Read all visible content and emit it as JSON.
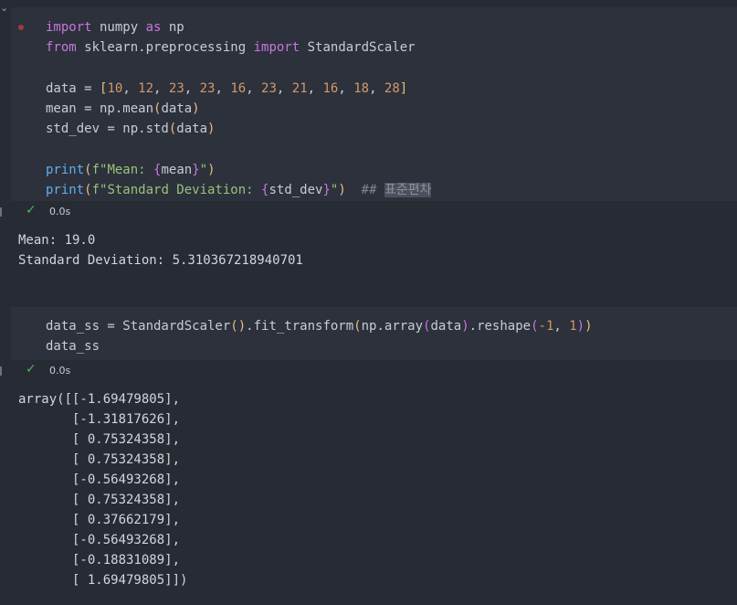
{
  "cell1": {
    "lines": [
      [
        [
          "kw",
          "import"
        ],
        [
          "id",
          " numpy "
        ],
        [
          "kw",
          "as"
        ],
        [
          "id",
          " np"
        ]
      ],
      [
        [
          "kw",
          "from"
        ],
        [
          "id",
          " sklearn.preprocessing "
        ],
        [
          "kw",
          "import"
        ],
        [
          "id",
          " StandardScaler"
        ]
      ],
      [],
      [
        [
          "id",
          "data = "
        ],
        [
          "br1",
          "["
        ],
        [
          "num",
          "10"
        ],
        [
          "id",
          ", "
        ],
        [
          "num",
          "12"
        ],
        [
          "id",
          ", "
        ],
        [
          "num",
          "23"
        ],
        [
          "id",
          ", "
        ],
        [
          "num",
          "23"
        ],
        [
          "id",
          ", "
        ],
        [
          "num",
          "16"
        ],
        [
          "id",
          ", "
        ],
        [
          "num",
          "23"
        ],
        [
          "id",
          ", "
        ],
        [
          "num",
          "21"
        ],
        [
          "id",
          ", "
        ],
        [
          "num",
          "16"
        ],
        [
          "id",
          ", "
        ],
        [
          "num",
          "18"
        ],
        [
          "id",
          ", "
        ],
        [
          "num",
          "28"
        ],
        [
          "br1",
          "]"
        ]
      ],
      [
        [
          "id",
          "mean = np.mean"
        ],
        [
          "br1",
          "("
        ],
        [
          "id",
          "data"
        ],
        [
          "br1",
          ")"
        ]
      ],
      [
        [
          "id",
          "std_dev = np.std"
        ],
        [
          "br1",
          "("
        ],
        [
          "id",
          "data"
        ],
        [
          "br1",
          ")"
        ]
      ],
      [],
      [
        [
          "fn",
          "print"
        ],
        [
          "br1",
          "("
        ],
        [
          "str",
          "f\"Mean: "
        ],
        [
          "br2",
          "{"
        ],
        [
          "id",
          "mean"
        ],
        [
          "br2",
          "}"
        ],
        [
          "str",
          "\""
        ],
        [
          "br1",
          ")"
        ]
      ],
      [
        [
          "fn",
          "print"
        ],
        [
          "br1",
          "("
        ],
        [
          "str",
          "f\"Standard Deviation: "
        ],
        [
          "br2",
          "{"
        ],
        [
          "id",
          "std_dev"
        ],
        [
          "br2",
          "}"
        ],
        [
          "str",
          "\""
        ],
        [
          "br1",
          ")"
        ],
        [
          "id",
          "  "
        ],
        [
          "cmt",
          "## "
        ],
        [
          "cmt-hl",
          "표준편차"
        ]
      ]
    ],
    "status_time": "0.0s",
    "output": "Mean: 19.0\nStandard Deviation: 5.310367218940701"
  },
  "cell2": {
    "lines": [
      [
        [
          "id",
          "data_ss = StandardScaler"
        ],
        [
          "br1",
          "()"
        ],
        [
          "id",
          ".fit_transform"
        ],
        [
          "br1",
          "("
        ],
        [
          "id",
          "np.array"
        ],
        [
          "br2",
          "("
        ],
        [
          "id",
          "data"
        ],
        [
          "br2",
          ")"
        ],
        [
          "id",
          ".reshape"
        ],
        [
          "br2",
          "("
        ],
        [
          "num",
          "-1"
        ],
        [
          "id",
          ", "
        ],
        [
          "num",
          "1"
        ],
        [
          "br2",
          ")"
        ],
        [
          "br1",
          ")"
        ]
      ],
      [
        [
          "id",
          "data_ss"
        ]
      ]
    ],
    "status_time": "0.0s",
    "output": "array([[-1.69479805],\n       [-1.31817626],\n       [ 0.75324358],\n       [ 0.75324358],\n       [-0.56493268],\n       [ 0.75324358],\n       [ 0.37662179],\n       [-0.56493268],\n       [-0.18831089],\n       [ 1.69479805]])"
  },
  "icons": {
    "collapse": "chevron-down-icon",
    "success": "check-icon",
    "breakpoint": "breakpoint-dot-icon"
  },
  "colors": {
    "background": "#272b34",
    "cell": "#2c313c",
    "keyword": "#c678dd",
    "function": "#61afef",
    "number": "#d19a66",
    "string": "#98c379",
    "bracket": "#e5c07b",
    "success": "#4cb36a"
  }
}
